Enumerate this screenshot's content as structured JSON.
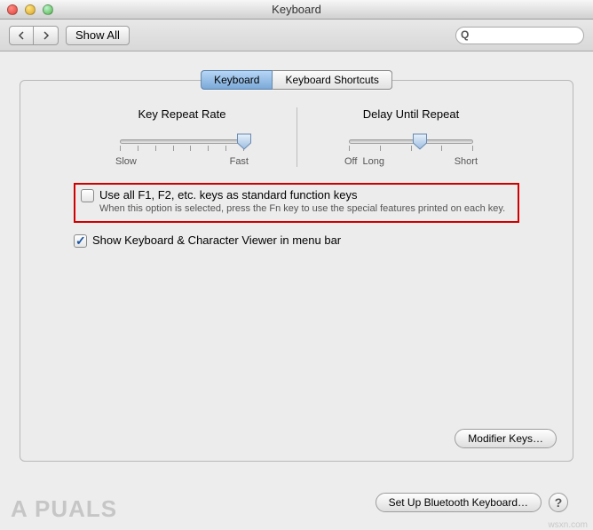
{
  "window": {
    "title": "Keyboard"
  },
  "toolbar": {
    "show_all": "Show All",
    "search_placeholder": ""
  },
  "tabs": {
    "keyboard": "Keyboard",
    "shortcuts": "Keyboard Shortcuts"
  },
  "slider1": {
    "title": "Key Repeat Rate",
    "left": "Slow",
    "right": "Fast",
    "thumb_pct": 100
  },
  "slider2": {
    "title": "Delay Until Repeat",
    "off": "Off",
    "left": "Long",
    "right": "Short",
    "thumb_pct": 57
  },
  "option_fn": {
    "checked": false,
    "label": "Use all F1, F2, etc. keys as standard function keys",
    "desc": "When this option is selected, press the Fn key to use the special features printed on each key."
  },
  "option_viewer": {
    "checked": true,
    "label": "Show Keyboard & Character Viewer in menu bar"
  },
  "buttons": {
    "modifier": "Modifier Keys…",
    "bluetooth": "Set Up Bluetooth Keyboard…"
  },
  "watermark": "A  PUALS",
  "wsxn": "wsxn.com"
}
